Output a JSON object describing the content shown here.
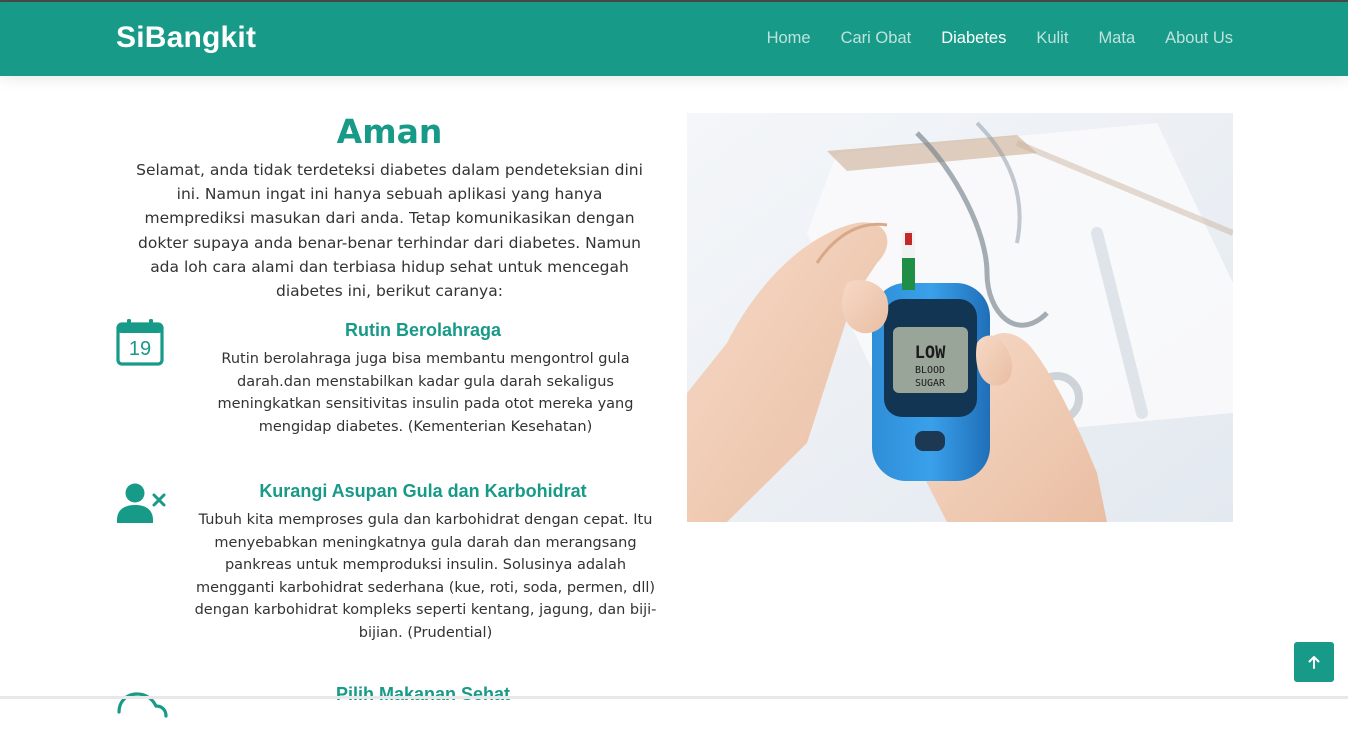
{
  "brand": "SiBangkit",
  "nav": {
    "items": [
      "Home",
      "Cari Obat",
      "Diabetes",
      "Kulit",
      "Mata",
      "About Us"
    ],
    "active": "Diabetes"
  },
  "result": {
    "title": "Aman",
    "intro": "Selamat, anda tidak terdeteksi diabetes dalam pendeteksian dini ini. Namun ingat ini hanya sebuah aplikasi yang hanya memprediksi masukan dari anda. Tetap komunikasikan dengan dokter supaya anda benar-benar terhindar dari diabetes. Namun ada loh cara alami dan terbiasa hidup sehat untuk mencegah diabetes ini, berikut caranya:"
  },
  "tips": [
    {
      "icon": "calendar-icon",
      "icon_text": "19",
      "title": "Rutin Berolahraga",
      "description": "Rutin berolahraga juga bisa membantu mengontrol gula darah.dan menstabilkan kadar gula darah sekaligus meningkatkan sensitivitas insulin pada otot mereka yang mengidap diabetes. (Kementerian Kesehatan)"
    },
    {
      "icon": "user-remove-icon",
      "title": "Kurangi Asupan Gula dan Karbohidrat",
      "description": "Tubuh kita memproses gula dan karbohidrat dengan cepat. Itu menyebabkan meningkatnya gula darah dan merangsang pankreas untuk memproduksi insulin. Solusinya adalah mengganti karbohidrat sederhana (kue, roti, soda, permen, dll) dengan karbohidrat kompleks seperti kentang, jagung, dan biji-bijian. (Prudential)"
    },
    {
      "icon": "cloud-icon",
      "title": "Pilih Makanan Sehat",
      "description": ""
    }
  ],
  "hero_image": {
    "meter_text": [
      "LOW",
      "BLOOD",
      "SUGAR"
    ]
  },
  "colors": {
    "primary": "#179a88",
    "text": "#333333"
  },
  "back_to_top_icon": "arrow-up-icon"
}
